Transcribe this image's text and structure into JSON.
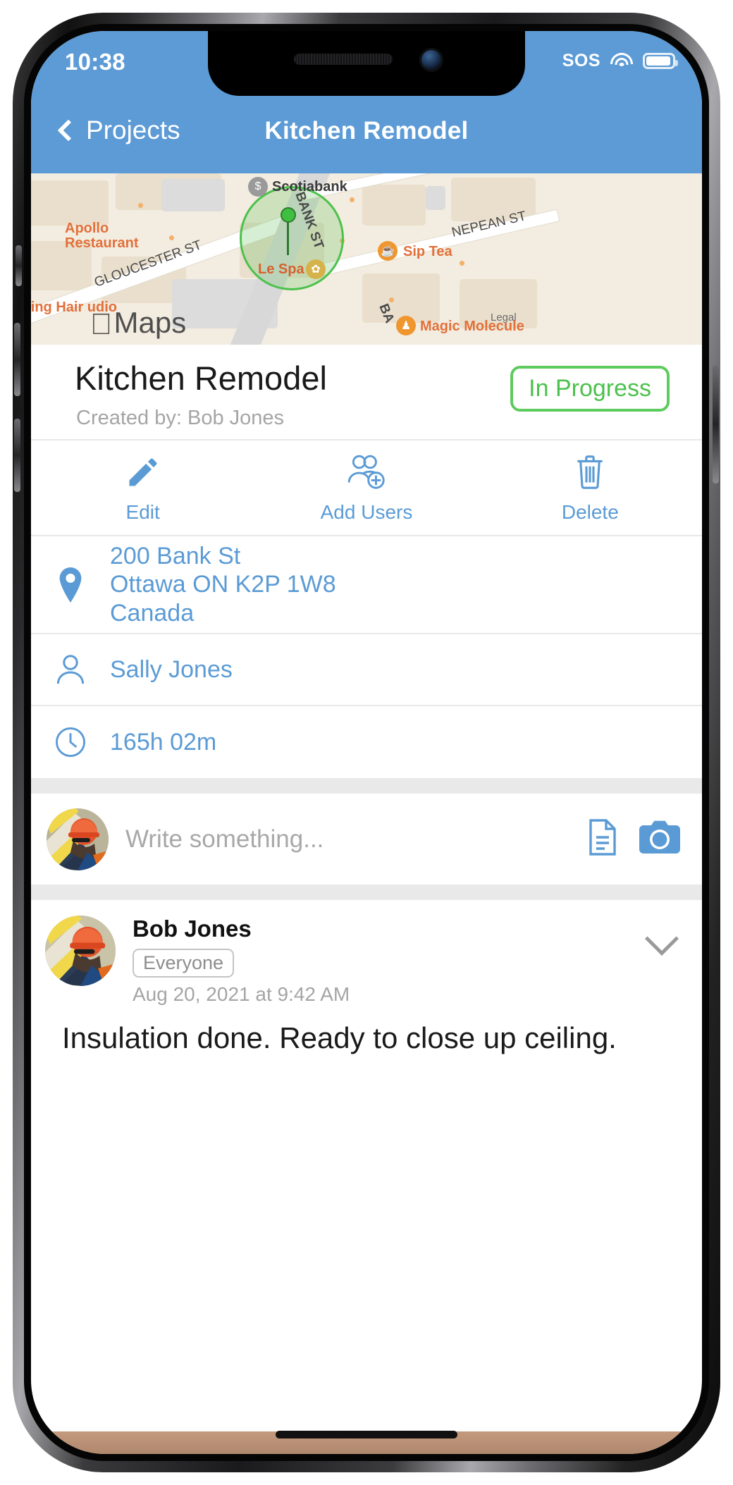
{
  "status_bar": {
    "time": "10:38",
    "sos_label": "SOS",
    "wifi_icon": "wifi-icon",
    "battery_icon": "battery-icon"
  },
  "nav_bar": {
    "back_label": "Projects",
    "back_icon": "chevron-left-icon",
    "title": "Kitchen Remodel"
  },
  "map": {
    "watermark": "Maps",
    "apple_glyph": "",
    "street_labels": [
      "GLOUCESTER ST",
      "BANK ST",
      "NEPEAN ST",
      "BA",
      "Legal"
    ],
    "pois": [
      {
        "name": "Scotiabank",
        "icon": "bank-icon"
      },
      {
        "name": "Apollo Restaurant",
        "icon": "restaurant-label"
      },
      {
        "name": "Sip Tea",
        "icon": "cafe-icon"
      },
      {
        "name": "Le Spa",
        "icon": "spa-icon"
      },
      {
        "name": "Magic Molecule",
        "icon": "shop-icon"
      },
      {
        "name": "ring Hair udio",
        "icon": "salon-label"
      }
    ],
    "pin_icon": "map-pin-marker"
  },
  "project": {
    "title": "Kitchen Remodel",
    "created_by": "Created by: Bob Jones",
    "status": "In Progress",
    "status_color": "#4cc14c"
  },
  "actions": [
    {
      "label": "Edit",
      "icon": "pencil-icon"
    },
    {
      "label": "Add Users",
      "icon": "add-users-icon"
    },
    {
      "label": "Delete",
      "icon": "trash-icon"
    }
  ],
  "details": {
    "address_icon": "location-pin-icon",
    "address_line1": "200 Bank St",
    "address_line2": "Ottawa ON K2P 1W8",
    "address_line3": "Canada",
    "person_icon": "person-icon",
    "person": "Sally Jones",
    "time_icon": "clock-icon",
    "time_total": "165h 02m"
  },
  "composer": {
    "avatar_icon": "user-avatar",
    "placeholder": "Write something...",
    "document_icon": "document-icon",
    "camera_icon": "camera-icon"
  },
  "comment": {
    "avatar_icon": "user-avatar",
    "author": "Bob Jones",
    "audience": "Everyone",
    "timestamp": "Aug 20, 2021 at 9:42 AM",
    "body": "Insulation done. Ready to close up ceiling.",
    "collapse_icon": "chevron-down-icon"
  },
  "colors": {
    "nav_blue": "#5c9bd6",
    "link_blue": "#5b9bd5",
    "accent_green": "#4cc14c",
    "muted_gray": "#a5a5a5"
  }
}
